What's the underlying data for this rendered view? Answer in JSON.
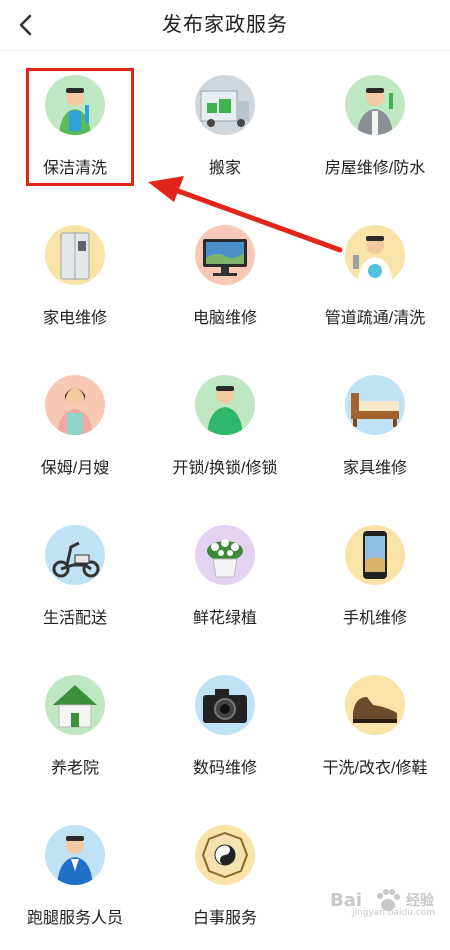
{
  "header": {
    "title": "发布家政服务",
    "back_icon": "chevron-left-icon"
  },
  "services": [
    {
      "label": "保洁清洗",
      "icon": "cleaner-icon",
      "bg": "#bfe7c2"
    },
    {
      "label": "搬家",
      "icon": "moving-truck-icon",
      "bg": "#cfd6dc"
    },
    {
      "label": "房屋维修/防水",
      "icon": "repairman-icon",
      "bg": "#bfe7c2"
    },
    {
      "label": "家电维修",
      "icon": "refrigerator-icon",
      "bg": "#f9e3a7"
    },
    {
      "label": "电脑维修",
      "icon": "computer-monitor-icon",
      "bg": "#f7c9b5"
    },
    {
      "label": "管道疏通/清洗",
      "icon": "plumber-icon",
      "bg": "#f9e3a7"
    },
    {
      "label": "保姆/月嫂",
      "icon": "nanny-icon",
      "bg": "#f7c9b5"
    },
    {
      "label": "开锁/换锁/修锁",
      "icon": "locksmith-icon",
      "bg": "#bfe7c2"
    },
    {
      "label": "家具维修",
      "icon": "bed-furniture-icon",
      "bg": "#bfe2f5"
    },
    {
      "label": "生活配送",
      "icon": "delivery-scooter-icon",
      "bg": "#bfe2f5"
    },
    {
      "label": "鲜花绿植",
      "icon": "flower-pot-icon",
      "bg": "#e3d2f2"
    },
    {
      "label": "手机维修",
      "icon": "smartphone-icon",
      "bg": "#f9e3a7"
    },
    {
      "label": "养老院",
      "icon": "house-icon",
      "bg": "#bfe7c2"
    },
    {
      "label": "数码维修",
      "icon": "camera-icon",
      "bg": "#bfe2f5"
    },
    {
      "label": "干洗/改衣/修鞋",
      "icon": "shoe-icon",
      "bg": "#f9e3a7"
    },
    {
      "label": "跑腿服务人员",
      "icon": "businessman-icon",
      "bg": "#bfe2f5"
    },
    {
      "label": "白事服务",
      "icon": "bagua-icon",
      "bg": "#f9e3a7"
    }
  ],
  "watermark": {
    "text": "Bai",
    "text2": "经验",
    "sub": "jingyan.baidu.com"
  },
  "colors": {
    "highlight": "#e1251b",
    "arrow": "#e1251b"
  }
}
